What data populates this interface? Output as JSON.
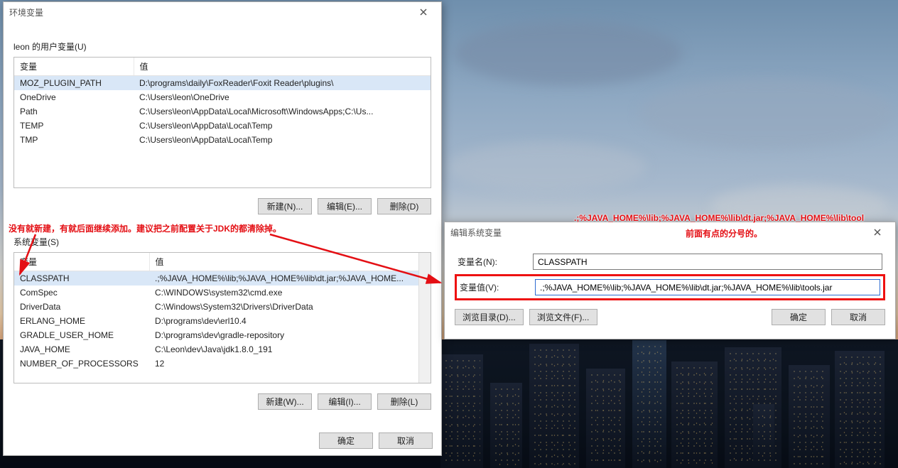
{
  "env_dialog": {
    "title": "环境变量",
    "user_section_label": "leon 的用户变量(U)",
    "sys_section_label": "系统变量(S)",
    "col_var": "变量",
    "col_val": "值",
    "user_vars": [
      {
        "name": "MOZ_PLUGIN_PATH",
        "value": "D:\\programs\\daily\\FoxReader\\Foxit Reader\\plugins\\",
        "sel": true
      },
      {
        "name": "OneDrive",
        "value": "C:\\Users\\leon\\OneDrive"
      },
      {
        "name": "Path",
        "value": "C:\\Users\\leon\\AppData\\Local\\Microsoft\\WindowsApps;C:\\Us..."
      },
      {
        "name": "TEMP",
        "value": "C:\\Users\\leon\\AppData\\Local\\Temp"
      },
      {
        "name": "TMP",
        "value": "C:\\Users\\leon\\AppData\\Local\\Temp"
      }
    ],
    "sys_vars": [
      {
        "name": "CLASSPATH",
        "value": ".;%JAVA_HOME%\\lib;%JAVA_HOME%\\lib\\dt.jar;%JAVA_HOME...",
        "sel": true
      },
      {
        "name": "ComSpec",
        "value": "C:\\WINDOWS\\system32\\cmd.exe"
      },
      {
        "name": "DriverData",
        "value": "C:\\Windows\\System32\\Drivers\\DriverData"
      },
      {
        "name": "ERLANG_HOME",
        "value": "D:\\programs\\dev\\erl10.4"
      },
      {
        "name": "GRADLE_USER_HOME",
        "value": "D:\\programs\\dev\\gradle-repository"
      },
      {
        "name": "JAVA_HOME",
        "value": "C:\\Leon\\dev\\Java\\jdk1.8.0_191"
      },
      {
        "name": "NUMBER_OF_PROCESSORS",
        "value": "12"
      }
    ],
    "btn_new_u": "新建(N)...",
    "btn_edit_u": "编辑(E)...",
    "btn_del_u": "删除(D)",
    "btn_new_s": "新建(W)...",
    "btn_edit_s": "编辑(I)...",
    "btn_del_s": "删除(L)",
    "btn_ok": "确定",
    "btn_cancel": "取消"
  },
  "edit_dialog": {
    "title": "编辑系统变量",
    "name_label": "变量名(N):",
    "value_label": "变量值(V):",
    "name_value": "CLASSPATH",
    "value_value": ".;%JAVA_HOME%\\lib;%JAVA_HOME%\\lib\\dt.jar;%JAVA_HOME%\\lib\\tools.jar",
    "btn_browse_dir": "浏览目录(D)...",
    "btn_browse_file": "浏览文件(F)...",
    "btn_ok": "确定",
    "btn_cancel": "取消"
  },
  "annotations": {
    "left": "没有就新建，有就后面继续添加。建议把之前配置关于JDK的都清除掉。",
    "right_top": ".;%JAVA_HOME%\\lib;%JAVA_HOME%\\lib\\dt.jar;%JAVA_HOME%\\lib\\tool",
    "right_sub": "前面有点的分号的。"
  }
}
